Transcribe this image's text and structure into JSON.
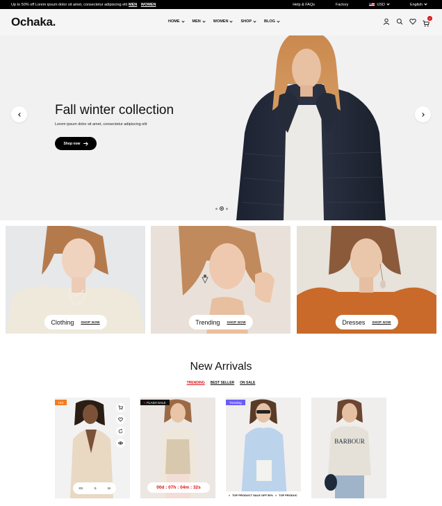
{
  "topbar": {
    "promo": "Up to 50% off Lorem ipsum dolor sit amet, consectetur adipiscing elit",
    "links": [
      "MEN",
      "WOMEN"
    ],
    "help": "Help & FAQs",
    "factory": "Factory",
    "currency": "USD",
    "language": "English"
  },
  "header": {
    "logo": "Ochaka.",
    "nav": [
      "HOME",
      "MEN",
      "WOMEN",
      "SHOP",
      "BLOG"
    ],
    "cart_count": "0"
  },
  "hero": {
    "title": "Fall winter collection",
    "subtitle": "Lorem ipsum dolor sit amet, consectetur adipiscing elit",
    "button": "Shop now",
    "slide_count": 3,
    "active_slide": 2
  },
  "categories": [
    {
      "name": "Clothing",
      "link": "SHOP NOW"
    },
    {
      "name": "Trending",
      "link": "SHOP NOW"
    },
    {
      "name": "Dresses",
      "link": "SHOP NOW"
    }
  ],
  "arrivals": {
    "title": "New Arrivals",
    "tabs": [
      "TRENDING",
      "BEST SELLER",
      "ON SALE"
    ],
    "products": [
      {
        "badge": "Hot",
        "sizes": [
          "XS",
          "S",
          "M"
        ]
      },
      {
        "badge": "FLASH SALE",
        "countdown": "00d : 07h : 04m : 32s"
      },
      {
        "badge": "Trending",
        "marquee": [
          "TOP PRODUCT SALE OFF 50%",
          "TOP PRODUC"
        ]
      },
      {
        "badge": ""
      }
    ]
  },
  "colors": {
    "accent": "#db1215",
    "hot_badge": "#f47b20",
    "trending_badge": "#6a5cf6"
  }
}
